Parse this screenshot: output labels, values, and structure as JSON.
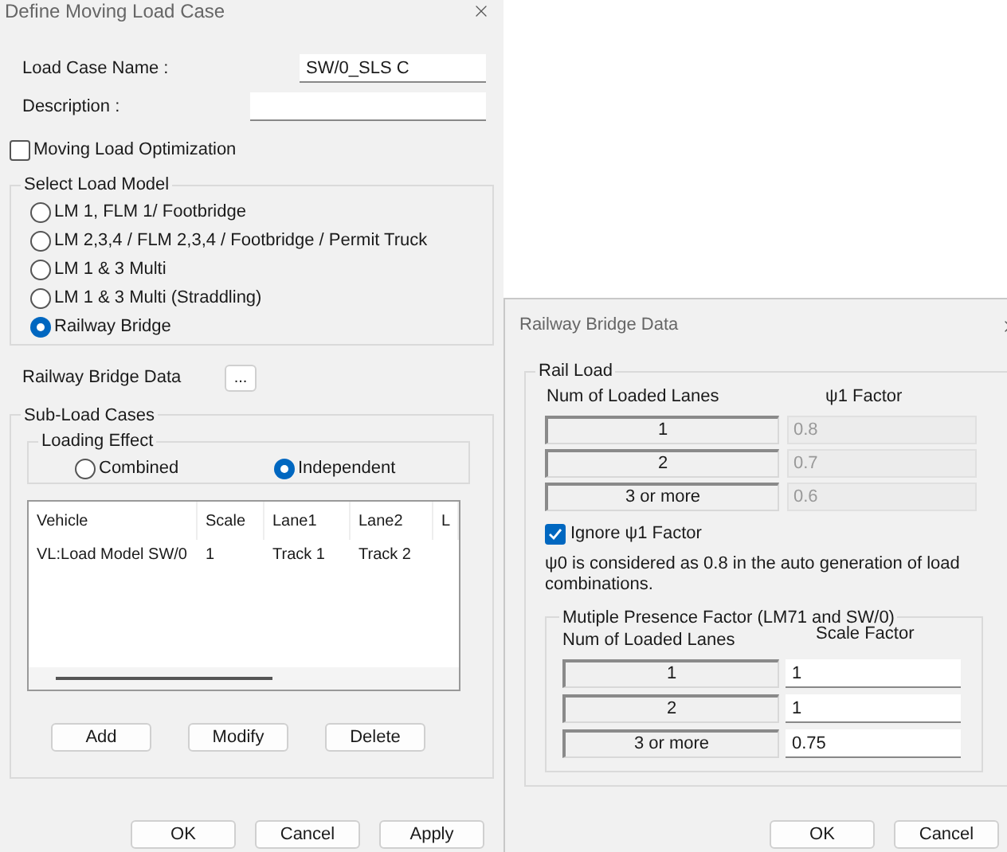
{
  "main_dialog": {
    "title": "Define Moving Load Case",
    "load_case_name": {
      "label": "Load Case Name :",
      "value": "SW/0_SLS C"
    },
    "description": {
      "label": "Description :"
    },
    "moving_load_optimization": {
      "label": "Moving Load Optimization",
      "checked": false
    },
    "select_load_model": {
      "title": "Select Load Model",
      "options": [
        {
          "label": "LM 1, FLM 1/ Footbridge",
          "selected": false
        },
        {
          "label": "LM 2,3,4 / FLM 2,3,4 / Footbridge / Permit Truck",
          "selected": false
        },
        {
          "label": "LM 1 & 3 Multi",
          "selected": false
        },
        {
          "label": "LM 1 & 3 Multi (Straddling)",
          "selected": false
        },
        {
          "label": "Railway Bridge",
          "selected": true
        }
      ]
    },
    "railway_bridge_data": {
      "label": "Railway Bridge Data",
      "button": "..."
    },
    "sub_load_cases": {
      "title": "Sub-Load Cases",
      "loading_effect": {
        "title": "Loading Effect",
        "options": [
          {
            "label": "Combined",
            "selected": false
          },
          {
            "label": "Independent",
            "selected": true
          }
        ]
      },
      "table": {
        "columns": [
          "Vehicle",
          "Scale",
          "Lane1",
          "Lane2",
          "L"
        ],
        "rows": [
          [
            "VL:Load Model SW/0",
            "1",
            "Track 1",
            "Track 2"
          ]
        ]
      },
      "buttons": [
        "Add",
        "Modify",
        "Delete"
      ]
    },
    "buttons": [
      "OK",
      "Cancel",
      "Apply"
    ]
  },
  "railway_bridge_dialog": {
    "title": "Railway Bridge Data",
    "rail_load": {
      "title": "Rail Load",
      "columns": [
        "Num of Loaded Lanes",
        "ψ1 Factor"
      ],
      "rows": [
        {
          "lanes": "1",
          "factor": "0.8",
          "disabled": true
        },
        {
          "lanes": "2",
          "factor": "0.7",
          "disabled": true
        },
        {
          "lanes": "3 or more",
          "factor": "0.6",
          "disabled": true
        }
      ],
      "ignore_factor": {
        "label": "Ignore ψ1 Factor",
        "checked": true
      },
      "note": "ψ0 is considered as 0.8 in the auto generation of load combinations.",
      "multiple_presence": {
        "title": "Mutiple Presence Factor (LM71 and SW/0)",
        "columns": [
          "Num of Loaded Lanes",
          "Scale Factor"
        ],
        "rows": [
          {
            "lanes": "1",
            "factor": "1"
          },
          {
            "lanes": "2",
            "factor": "1"
          },
          {
            "lanes": "3 or more",
            "factor": "0.75"
          }
        ]
      }
    },
    "buttons": [
      "OK",
      "Cancel"
    ]
  }
}
